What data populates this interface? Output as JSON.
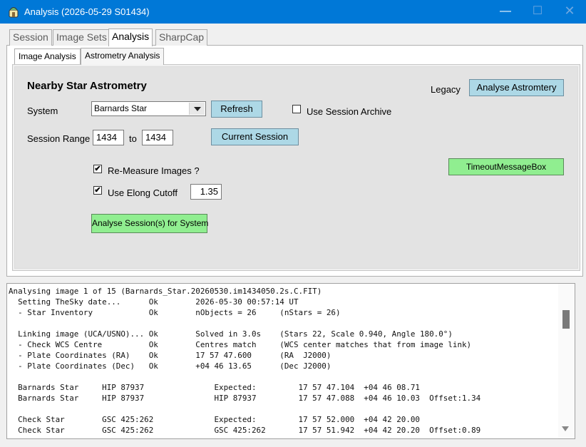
{
  "window": {
    "title": "Analysis (2026-05-29 S01434)"
  },
  "outer_tabs": [
    {
      "label": "Session"
    },
    {
      "label": "Image Sets"
    },
    {
      "label": "Analysis"
    },
    {
      "label": "SharpCap"
    }
  ],
  "inner_tabs": [
    {
      "label": "Image Analysis"
    },
    {
      "label": "Astrometry Analysis"
    }
  ],
  "panel": {
    "heading": "Nearby Star Astrometry",
    "legacy_label": "Legacy",
    "analyse_astrometry_label": "Analyse Astromtery",
    "system_label": "System",
    "system_value": "Barnards Star",
    "refresh_label": "Refresh",
    "use_archive_label": "Use Session Archive",
    "session_range_label": "Session Range",
    "range_from": "1434",
    "range_to_label": "to",
    "range_to": "1434",
    "current_session_label": "Current Session",
    "timeout_label": "TimeoutMessageBox",
    "remeasure_label": "Re-Measure Images ?",
    "remeasure_checked": "✔",
    "elong_label": "Use Elong Cutoff",
    "elong_checked": "✔",
    "elong_value": "1.35",
    "analyse_sessions_label": "Analyse Session(s) for System"
  },
  "log": {
    "text": "Analysing image 1 of 15 (Barnards_Star.20260530.im1434050.2s.C.FIT)\n  Setting TheSky date...      Ok        2026-05-30 00:57:14 UT\n  - Star Inventory            Ok        nObjects = 26     (nStars = 26)\n\n  Linking image (UCA/USNO)... Ok        Solved in 3.0s    (Stars 22, Scale 0.940, Angle 180.0°)\n  - Check WCS Centre          Ok        Centres match     (WCS center matches that from image link)\n  - Plate Coordinates (RA)    Ok        17 57 47.600      (RA  J2000)\n  - Plate Coordinates (Dec)   Ok        +04 46 13.65      (Dec J2000)\n\n  Barnards Star     HIP 87937               Expected:         17 57 47.104  +04 46 08.71\n  Barnards Star     HIP 87937               HIP 87937         17 57 47.088  +04 46 10.03  Offset:1.34\n\n  Check Star        GSC 425:262             Expected:         17 57 52.000  +04 42 20.00\n  Check Star        GSC 425:262             GSC 425:262       17 57 51.942  +04 42 20.20  Offset:0.89"
  }
}
